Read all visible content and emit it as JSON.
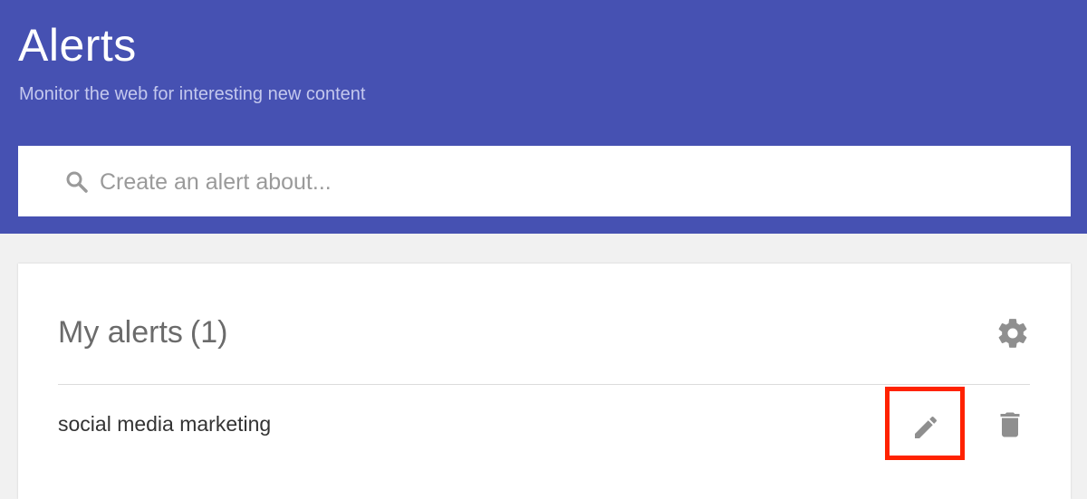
{
  "header": {
    "title": "Alerts",
    "subtitle": "Monitor the web for interesting new content",
    "background_color": "#4651b2"
  },
  "search": {
    "placeholder": "Create an alert about...",
    "value": "",
    "icon": "search-icon"
  },
  "alerts_panel": {
    "title": "My alerts",
    "count": "(1)",
    "settings_icon": "gear-icon",
    "items": [
      {
        "label": "social media marketing",
        "edit_icon": "pencil-icon",
        "delete_icon": "trash-icon"
      }
    ]
  },
  "highlight_color": "#ff2200"
}
